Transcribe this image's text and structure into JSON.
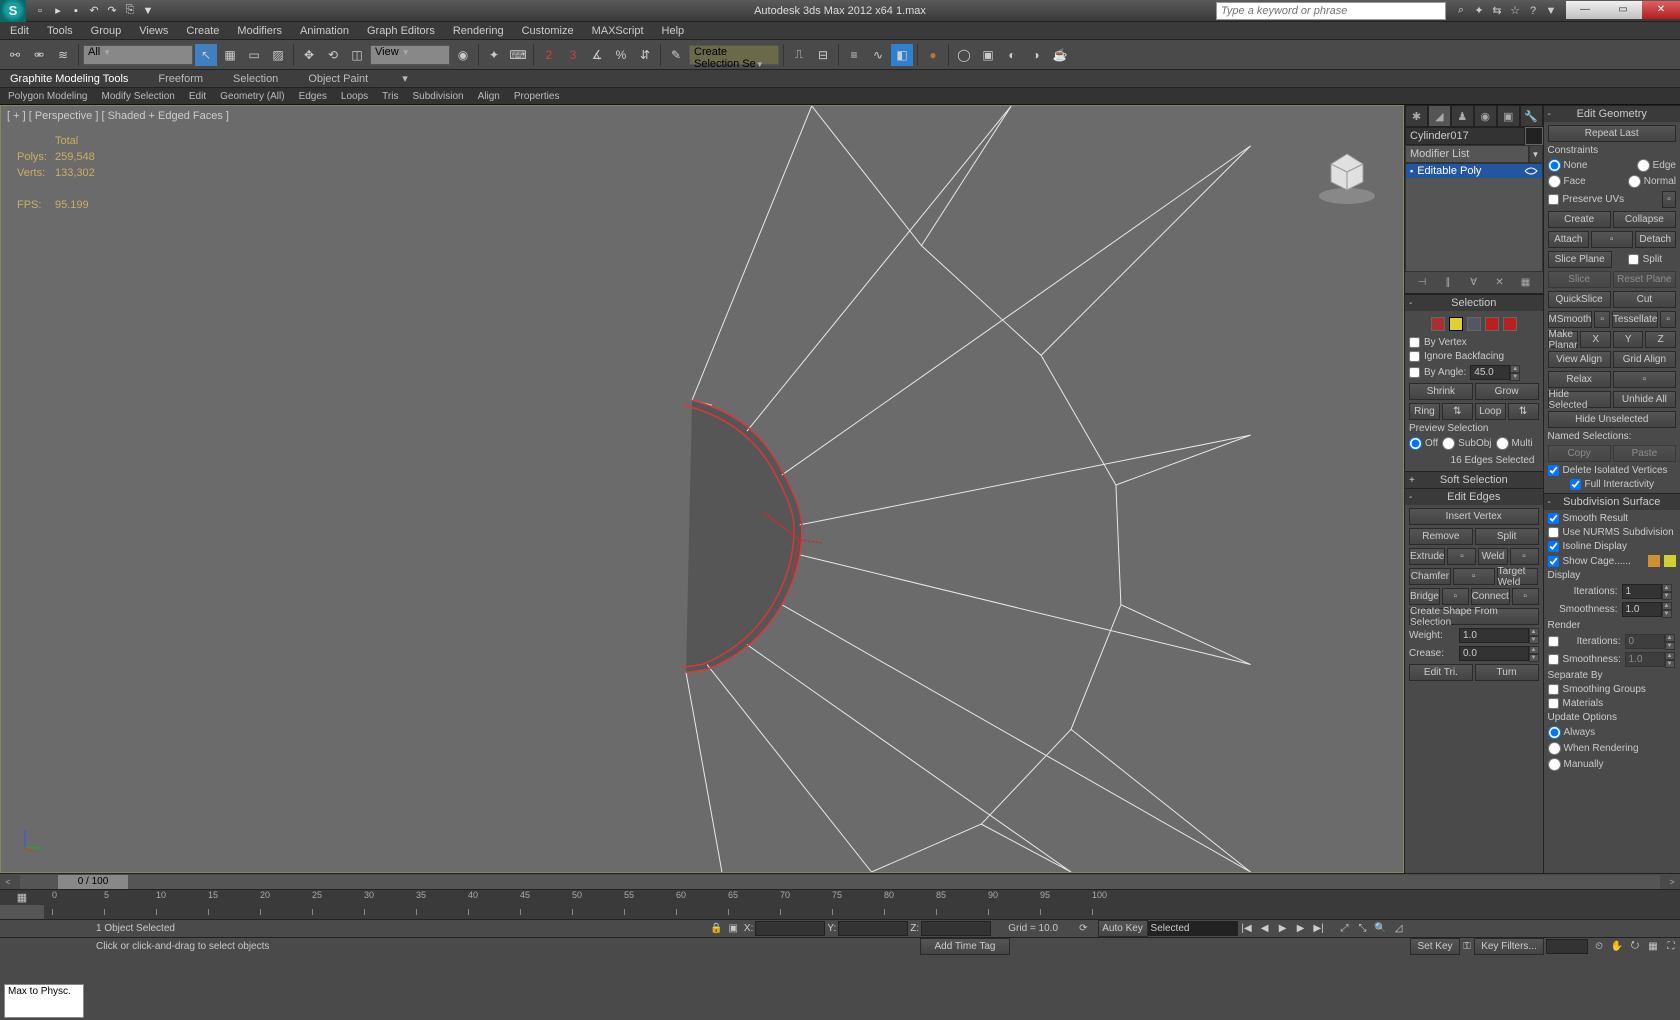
{
  "titlebar": {
    "title": "Autodesk 3ds Max 2012 x64    1.max",
    "search_placeholder": "Type a keyword or phrase"
  },
  "menus": [
    "Edit",
    "Tools",
    "Group",
    "Views",
    "Create",
    "Modifiers",
    "Animation",
    "Graph Editors",
    "Rendering",
    "Customize",
    "MAXScript",
    "Help"
  ],
  "toolbar": {
    "filter_combo": "All",
    "view_combo": "View",
    "create_sel_combo": "Create Selection Se"
  },
  "ribbon": {
    "tabs": [
      "Graphite Modeling Tools",
      "Freeform",
      "Selection",
      "Object Paint"
    ],
    "sub": [
      "Polygon Modeling",
      "Modify Selection",
      "Edit",
      "Geometry (All)",
      "Edges",
      "Loops",
      "Tris",
      "Subdivision",
      "Align",
      "Properties"
    ]
  },
  "viewport": {
    "label": "[ + ]  [ Perspective ]  [ Shaded + Edged Faces ]",
    "stats": {
      "total_label": "Total",
      "polys_label": "Polys:",
      "polys": "259,548",
      "verts_label": "Verts:",
      "verts": "133,302",
      "fps_label": "FPS:",
      "fps": "95.199"
    }
  },
  "cmd": {
    "objname": "Cylinder017",
    "modlist": "Modifier List",
    "modstack_item": "Editable Poly"
  },
  "selection": {
    "title": "Selection",
    "by_vertex": "By Vertex",
    "ignore_bf": "Ignore Backfacing",
    "by_angle": "By Angle:",
    "angle_val": "45.0",
    "shrink": "Shrink",
    "grow": "Grow",
    "ring": "Ring",
    "loop": "Loop",
    "preview": "Preview Selection",
    "off": "Off",
    "subobj": "SubObj",
    "multi": "Multi",
    "status": "16 Edges Selected"
  },
  "softsel": {
    "title": "Soft Selection"
  },
  "editedges": {
    "title": "Edit Edges",
    "insert_vertex": "Insert Vertex",
    "remove": "Remove",
    "split": "Split",
    "extrude": "Extrude",
    "weld": "Weld",
    "chamfer": "Chamfer",
    "target_weld": "Target Weld",
    "bridge": "Bridge",
    "connect": "Connect",
    "create_shape": "Create Shape From Selection",
    "weight": "Weight:",
    "weight_val": "1.0",
    "crease": "Crease:",
    "crease_val": "0.0",
    "edit_tri": "Edit Tri.",
    "turn": "Turn"
  },
  "editgeo": {
    "title": "Edit Geometry",
    "repeat": "Repeat Last",
    "constraints": "Constraints",
    "none": "None",
    "edge": "Edge",
    "face": "Face",
    "normal": "Normal",
    "preserve_uvs": "Preserve UVs",
    "create": "Create",
    "collapse": "Collapse",
    "attach": "Attach",
    "detach": "Detach",
    "slice_plane": "Slice Plane",
    "split": "Split",
    "slice": "Slice",
    "reset_plane": "Reset Plane",
    "quickslice": "QuickSlice",
    "cut": "Cut",
    "msmooth": "MSmooth",
    "tessellate": "Tessellate",
    "make_planar": "Make Planar",
    "view_align": "View Align",
    "grid_align": "Grid Align",
    "relax": "Relax",
    "hide_sel": "Hide Selected",
    "unhide": "Unhide All",
    "hide_unsel": "Hide Unselected",
    "named_sel": "Named Selections:",
    "copy": "Copy",
    "paste": "Paste",
    "del_iso": "Delete Isolated Vertices",
    "full_int": "Full Interactivity"
  },
  "subsurf": {
    "title": "Subdivision Surface",
    "smooth_result": "Smooth Result",
    "use_nurms": "Use NURMS Subdivision",
    "isoline": "Isoline Display",
    "show_cage": "Show Cage......",
    "display": "Display",
    "iterations": "Iterations:",
    "iter_val": "1",
    "smoothness": "Smoothness:",
    "smooth_val": "1.0",
    "render": "Render",
    "r_iter_val": "0",
    "r_smooth_val": "1.0",
    "separate": "Separate By",
    "smoothing_groups": "Smoothing Groups",
    "materials": "Materials",
    "update": "Update Options",
    "always": "Always",
    "when_rendering": "When Rendering",
    "manually": "Manually"
  },
  "timeslider": {
    "pos": "0 / 100"
  },
  "statusbar": {
    "sel": "1 Object Selected",
    "prompt": "Click or click-and-drag to select objects",
    "grid": "Grid = 10.0",
    "x": "X:",
    "y": "Y:",
    "z": "Z:",
    "autokey": "Auto Key",
    "selected": "Selected",
    "setkey": "Set Key",
    "keyfilters": "Key Filters...",
    "add_time_tag": "Add Time Tag"
  },
  "maxscript": "Max to Physc."
}
